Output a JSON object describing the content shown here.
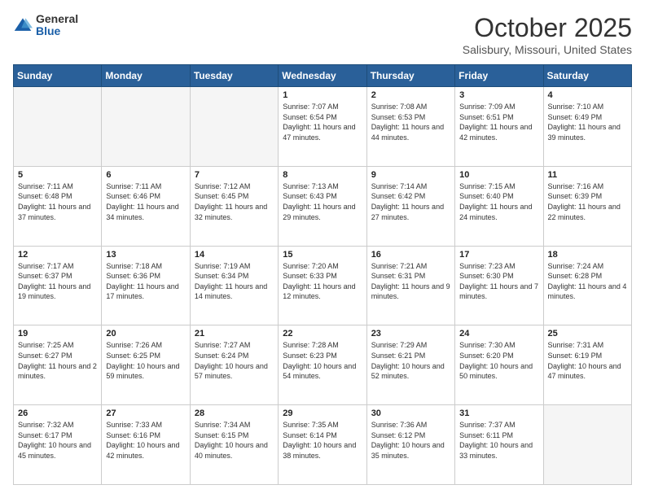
{
  "header": {
    "logo_general": "General",
    "logo_blue": "Blue",
    "month_title": "October 2025",
    "location": "Salisbury, Missouri, United States"
  },
  "days_of_week": [
    "Sunday",
    "Monday",
    "Tuesday",
    "Wednesday",
    "Thursday",
    "Friday",
    "Saturday"
  ],
  "weeks": [
    [
      {
        "day": "",
        "info": ""
      },
      {
        "day": "",
        "info": ""
      },
      {
        "day": "",
        "info": ""
      },
      {
        "day": "1",
        "info": "Sunrise: 7:07 AM\nSunset: 6:54 PM\nDaylight: 11 hours and 47 minutes."
      },
      {
        "day": "2",
        "info": "Sunrise: 7:08 AM\nSunset: 6:53 PM\nDaylight: 11 hours and 44 minutes."
      },
      {
        "day": "3",
        "info": "Sunrise: 7:09 AM\nSunset: 6:51 PM\nDaylight: 11 hours and 42 minutes."
      },
      {
        "day": "4",
        "info": "Sunrise: 7:10 AM\nSunset: 6:49 PM\nDaylight: 11 hours and 39 minutes."
      }
    ],
    [
      {
        "day": "5",
        "info": "Sunrise: 7:11 AM\nSunset: 6:48 PM\nDaylight: 11 hours and 37 minutes."
      },
      {
        "day": "6",
        "info": "Sunrise: 7:11 AM\nSunset: 6:46 PM\nDaylight: 11 hours and 34 minutes."
      },
      {
        "day": "7",
        "info": "Sunrise: 7:12 AM\nSunset: 6:45 PM\nDaylight: 11 hours and 32 minutes."
      },
      {
        "day": "8",
        "info": "Sunrise: 7:13 AM\nSunset: 6:43 PM\nDaylight: 11 hours and 29 minutes."
      },
      {
        "day": "9",
        "info": "Sunrise: 7:14 AM\nSunset: 6:42 PM\nDaylight: 11 hours and 27 minutes."
      },
      {
        "day": "10",
        "info": "Sunrise: 7:15 AM\nSunset: 6:40 PM\nDaylight: 11 hours and 24 minutes."
      },
      {
        "day": "11",
        "info": "Sunrise: 7:16 AM\nSunset: 6:39 PM\nDaylight: 11 hours and 22 minutes."
      }
    ],
    [
      {
        "day": "12",
        "info": "Sunrise: 7:17 AM\nSunset: 6:37 PM\nDaylight: 11 hours and 19 minutes."
      },
      {
        "day": "13",
        "info": "Sunrise: 7:18 AM\nSunset: 6:36 PM\nDaylight: 11 hours and 17 minutes."
      },
      {
        "day": "14",
        "info": "Sunrise: 7:19 AM\nSunset: 6:34 PM\nDaylight: 11 hours and 14 minutes."
      },
      {
        "day": "15",
        "info": "Sunrise: 7:20 AM\nSunset: 6:33 PM\nDaylight: 11 hours and 12 minutes."
      },
      {
        "day": "16",
        "info": "Sunrise: 7:21 AM\nSunset: 6:31 PM\nDaylight: 11 hours and 9 minutes."
      },
      {
        "day": "17",
        "info": "Sunrise: 7:23 AM\nSunset: 6:30 PM\nDaylight: 11 hours and 7 minutes."
      },
      {
        "day": "18",
        "info": "Sunrise: 7:24 AM\nSunset: 6:28 PM\nDaylight: 11 hours and 4 minutes."
      }
    ],
    [
      {
        "day": "19",
        "info": "Sunrise: 7:25 AM\nSunset: 6:27 PM\nDaylight: 11 hours and 2 minutes."
      },
      {
        "day": "20",
        "info": "Sunrise: 7:26 AM\nSunset: 6:25 PM\nDaylight: 10 hours and 59 minutes."
      },
      {
        "day": "21",
        "info": "Sunrise: 7:27 AM\nSunset: 6:24 PM\nDaylight: 10 hours and 57 minutes."
      },
      {
        "day": "22",
        "info": "Sunrise: 7:28 AM\nSunset: 6:23 PM\nDaylight: 10 hours and 54 minutes."
      },
      {
        "day": "23",
        "info": "Sunrise: 7:29 AM\nSunset: 6:21 PM\nDaylight: 10 hours and 52 minutes."
      },
      {
        "day": "24",
        "info": "Sunrise: 7:30 AM\nSunset: 6:20 PM\nDaylight: 10 hours and 50 minutes."
      },
      {
        "day": "25",
        "info": "Sunrise: 7:31 AM\nSunset: 6:19 PM\nDaylight: 10 hours and 47 minutes."
      }
    ],
    [
      {
        "day": "26",
        "info": "Sunrise: 7:32 AM\nSunset: 6:17 PM\nDaylight: 10 hours and 45 minutes."
      },
      {
        "day": "27",
        "info": "Sunrise: 7:33 AM\nSunset: 6:16 PM\nDaylight: 10 hours and 42 minutes."
      },
      {
        "day": "28",
        "info": "Sunrise: 7:34 AM\nSunset: 6:15 PM\nDaylight: 10 hours and 40 minutes."
      },
      {
        "day": "29",
        "info": "Sunrise: 7:35 AM\nSunset: 6:14 PM\nDaylight: 10 hours and 38 minutes."
      },
      {
        "day": "30",
        "info": "Sunrise: 7:36 AM\nSunset: 6:12 PM\nDaylight: 10 hours and 35 minutes."
      },
      {
        "day": "31",
        "info": "Sunrise: 7:37 AM\nSunset: 6:11 PM\nDaylight: 10 hours and 33 minutes."
      },
      {
        "day": "",
        "info": ""
      }
    ]
  ]
}
